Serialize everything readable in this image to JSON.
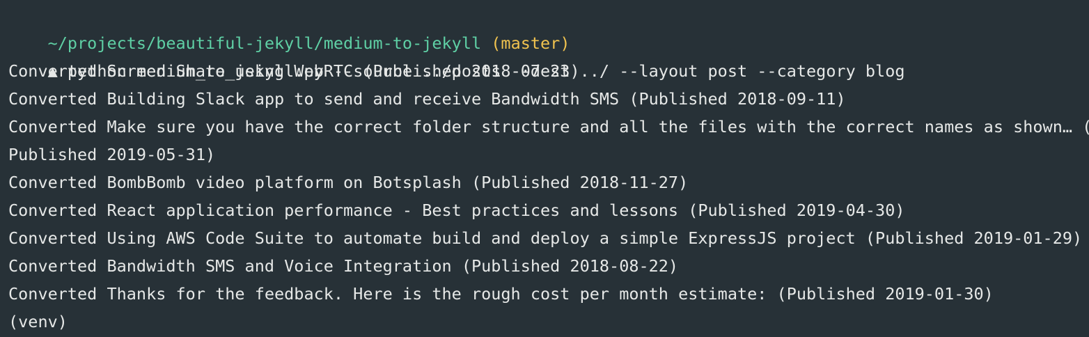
{
  "window": {
    "title": ""
  },
  "prompt": {
    "path": "~/projects/beautiful-jekyll/medium-to-jekyll",
    "branch": "(master)",
    "symbol": "▲",
    "command": "python medium_to_jekyll.py --source ../posts --dest ../ --layout post --category blog"
  },
  "output": [
    "Converted Screen Share using WebRTC (Published 2018-07-23)",
    "Converted Building Slack app to send and receive Bandwidth SMS (Published 2018-09-11)",
    "Converted Make sure you have the correct folder structure and all the files with the correct names as shown… (",
    "Published 2019-05-31)",
    "Converted BombBomb video platform on Botsplash (Published 2018-11-27)",
    "Converted React application performance - Best practices and lessons (Published 2019-04-30)",
    "Converted Using AWS Code Suite to automate build and deploy a simple ExpressJS project (Published 2019-01-29)",
    "Converted Bandwidth SMS and Voice Integration (Published 2018-08-22)",
    "Converted Thanks for the feedback. Here is the rough cost per month estimate: (Published 2019-01-30)"
  ],
  "venv": "(venv)",
  "colors": {
    "background": "#273137",
    "text": "#e6e8e7",
    "path": "#5fd0a5",
    "branch": "#f0c24f"
  }
}
